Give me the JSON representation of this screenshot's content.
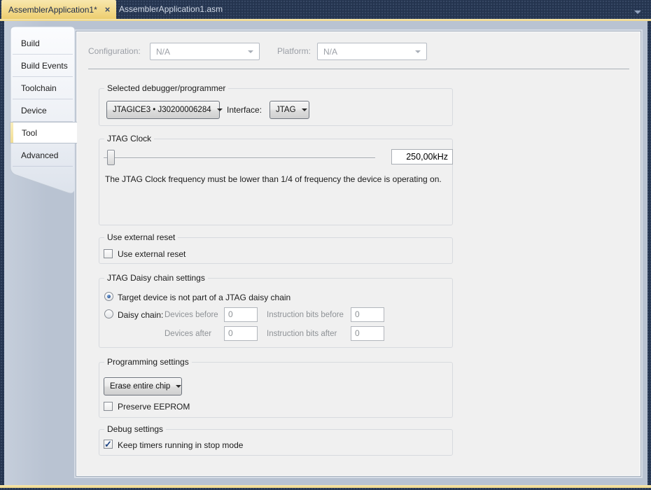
{
  "window": {
    "tabs": [
      {
        "label": "AssemblerApplication1*",
        "active": true
      },
      {
        "label": "AssemblerApplication1.asm",
        "active": false
      }
    ],
    "tab_close_icon": "×"
  },
  "sidebar": {
    "items": [
      {
        "label": "Build",
        "selected": false
      },
      {
        "label": "Build Events",
        "selected": false
      },
      {
        "label": "Toolchain",
        "selected": false
      },
      {
        "label": "Device",
        "selected": false
      },
      {
        "label": "Tool",
        "selected": true
      },
      {
        "label": "Advanced",
        "selected": false
      }
    ]
  },
  "header": {
    "configuration_label": "Configuration:",
    "configuration_value": "N/A",
    "platform_label": "Platform:",
    "platform_value": "N/A"
  },
  "debugger": {
    "group_title": "Selected debugger/programmer",
    "selected_debugger": "JTAGICE3 • J30200006284",
    "interface_label": "Interface:",
    "interface_value": "JTAG"
  },
  "jtag_clock": {
    "group_title": "JTAG Clock",
    "value": "250,00kHz",
    "hint": "The JTAG Clock frequency must be lower than 1/4 of frequency the device is operating on."
  },
  "external_reset": {
    "group_title": "Use external reset",
    "checkbox_label": "Use external reset",
    "checked": false
  },
  "daisy_chain": {
    "group_title": "JTAG Daisy chain settings",
    "option_not_part": "Target device is not part of a JTAG daisy chain",
    "option_not_part_selected": true,
    "option_daisy": "Daisy chain:",
    "option_daisy_selected": false,
    "devices_before_label": "Devices before",
    "devices_before_value": "0",
    "instruction_bits_before_label": "Instruction bits before",
    "instruction_bits_before_value": "0",
    "devices_after_label": "Devices after",
    "devices_after_value": "0",
    "instruction_bits_after_label": "Instruction bits after",
    "instruction_bits_after_value": "0"
  },
  "programming": {
    "group_title": "Programming settings",
    "erase_mode": "Erase entire chip",
    "preserve_eeprom_label": "Preserve EEPROM",
    "preserve_eeprom_checked": false
  },
  "debug": {
    "group_title": "Debug settings",
    "keep_timers_label": "Keep timers running in stop mode",
    "keep_timers_checked": true,
    "check_icon": "✓"
  },
  "colors": {
    "accent_gold": "#efd279",
    "shell_navy": "#24344f",
    "content_blue_gray": "#b9c3d2",
    "panel_bg": "#f0f0f0",
    "selection_blue": "#2a5496"
  }
}
